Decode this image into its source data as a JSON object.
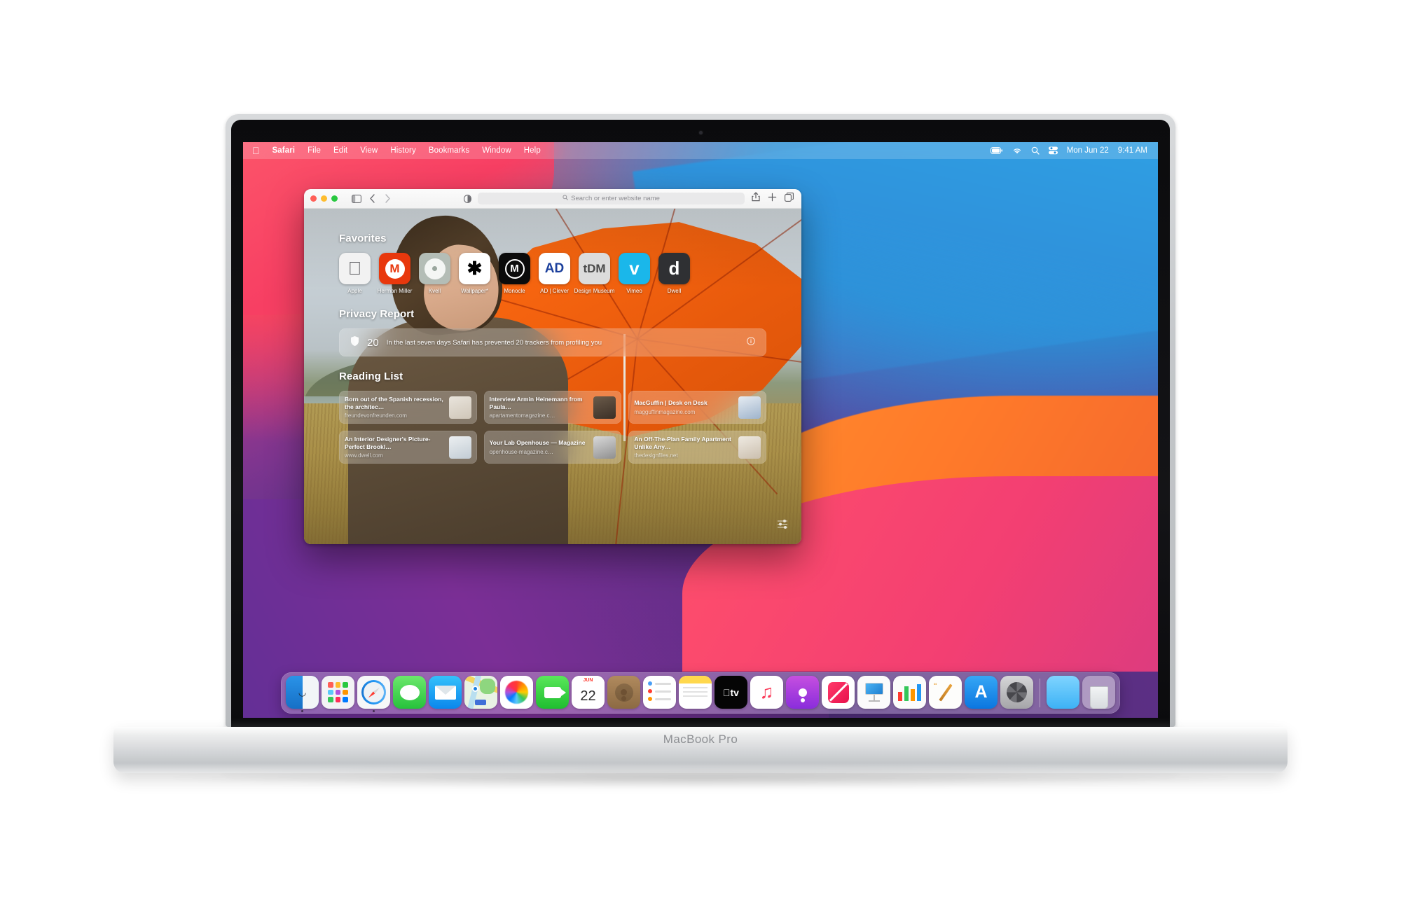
{
  "device": {
    "model_label": "MacBook Pro"
  },
  "menubar": {
    "apple_glyph": "",
    "items": [
      "Safari",
      "File",
      "Edit",
      "View",
      "History",
      "Bookmarks",
      "Window",
      "Help"
    ],
    "tray_icons": [
      "battery-icon",
      "wifi-icon",
      "search-icon",
      "control-center-icon"
    ],
    "date": "Mon Jun 22",
    "time": "9:41 AM"
  },
  "safari": {
    "window_controls": [
      "close",
      "minimize",
      "zoom"
    ],
    "toolbar_icons": [
      "sidebar-icon",
      "back-icon",
      "forward-icon",
      "reader-icon",
      "share-icon",
      "new-tab-icon",
      "tab-overview-icon"
    ],
    "address_bar": {
      "placeholder": "Search or enter website name",
      "value": "",
      "icon": "search-icon"
    },
    "start_page": {
      "favorites_heading": "Favorites",
      "favorites": [
        {
          "label": "Apple",
          "glyph": "",
          "bg": "#f2f2f2",
          "fg": "#5a5a5e",
          "size": 26
        },
        {
          "label": "Herman Miller",
          "glyph": "M",
          "bg": "#e8380d",
          "fg": "#ffffff",
          "size": 20
        },
        {
          "label": "Kvell",
          "glyph": "●",
          "bg": "#b4bdb6",
          "fg": "#8e9a92",
          "size": 13
        },
        {
          "label": "Wallpaper*",
          "glyph": "✱",
          "bg": "#ffffff",
          "fg": "#000000",
          "size": 26
        },
        {
          "label": "Monocle",
          "glyph": "M",
          "bg": "#0b0b0b",
          "fg": "#ffffff",
          "size": 20
        },
        {
          "label": "AD | Clever",
          "glyph": "AD",
          "bg": "#ffffff",
          "fg": "#1b3f9c",
          "size": 19
        },
        {
          "label": "Design Museum",
          "glyph": "tDM",
          "bg": "#dcdcdc",
          "fg": "#4a4a4a",
          "size": 17
        },
        {
          "label": "Vimeo",
          "glyph": "v",
          "bg": "#1ab7ea",
          "fg": "#ffffff",
          "size": 26
        },
        {
          "label": "Dwell",
          "glyph": "d",
          "bg": "#2f3033",
          "fg": "#ffffff",
          "size": 26
        }
      ],
      "privacy_heading": "Privacy Report",
      "privacy": {
        "shield_icon": "shield-icon",
        "count": "20",
        "message": "In the last seven days Safari has prevented 20 trackers from profiling you",
        "info_icon": "info-icon"
      },
      "reading_heading": "Reading List",
      "reading_list": [
        {
          "title": "Born out of the Spanish recession, the architec…",
          "url": "freundevonfreunden.com",
          "thumb": "interior-room"
        },
        {
          "title": "Interview Armin Heinemann from Paula…",
          "url": "apartamentomagazine.c…",
          "thumb": "dark-collage"
        },
        {
          "title": "MacGuffin | Desk on Desk",
          "url": "magguffinmagazine.com",
          "thumb": "blue-desk"
        },
        {
          "title": "An Interior Designer's Picture-Perfect Brookl…",
          "url": "www.dwell.com",
          "thumb": "desk-lamp"
        },
        {
          "title": "Your Lab Openhouse — Magazine",
          "url": "openhouse-magazine.c…",
          "thumb": "bw-figures"
        },
        {
          "title": "An Off-The-Plan Family Apartment Unlike Any…",
          "url": "thedesignfiles.net",
          "thumb": "kitchen-shelf"
        }
      ],
      "settings_icon": "sliders-icon"
    }
  },
  "dock": {
    "items": [
      {
        "name": "Finder",
        "running": true
      },
      {
        "name": "Launchpad",
        "running": false
      },
      {
        "name": "Safari",
        "running": true
      },
      {
        "name": "Messages",
        "running": false
      },
      {
        "name": "Mail",
        "running": false
      },
      {
        "name": "Maps",
        "running": false
      },
      {
        "name": "Photos",
        "running": false
      },
      {
        "name": "FaceTime",
        "running": false
      },
      {
        "name": "Calendar",
        "running": false
      },
      {
        "name": "Contacts",
        "running": false
      },
      {
        "name": "Reminders",
        "running": false
      },
      {
        "name": "Notes",
        "running": false
      },
      {
        "name": "TV",
        "running": false
      },
      {
        "name": "Music",
        "running": false
      },
      {
        "name": "Podcasts",
        "running": false
      },
      {
        "name": "News",
        "running": false
      },
      {
        "name": "Keynote",
        "running": false
      },
      {
        "name": "Numbers",
        "running": false
      },
      {
        "name": "Pages",
        "running": false
      },
      {
        "name": "App Store",
        "running": false
      },
      {
        "name": "System Preferences",
        "running": false
      },
      {
        "name": "Downloads",
        "running": false
      },
      {
        "name": "Trash",
        "running": false
      }
    ],
    "calendar": {
      "month": "JUN",
      "day": "22"
    }
  },
  "colors": {
    "accent_orange": "#ff6a10",
    "safari_blue": "#1e8fe0",
    "dock_glass": "rgba(255,255,255,0.26)"
  }
}
